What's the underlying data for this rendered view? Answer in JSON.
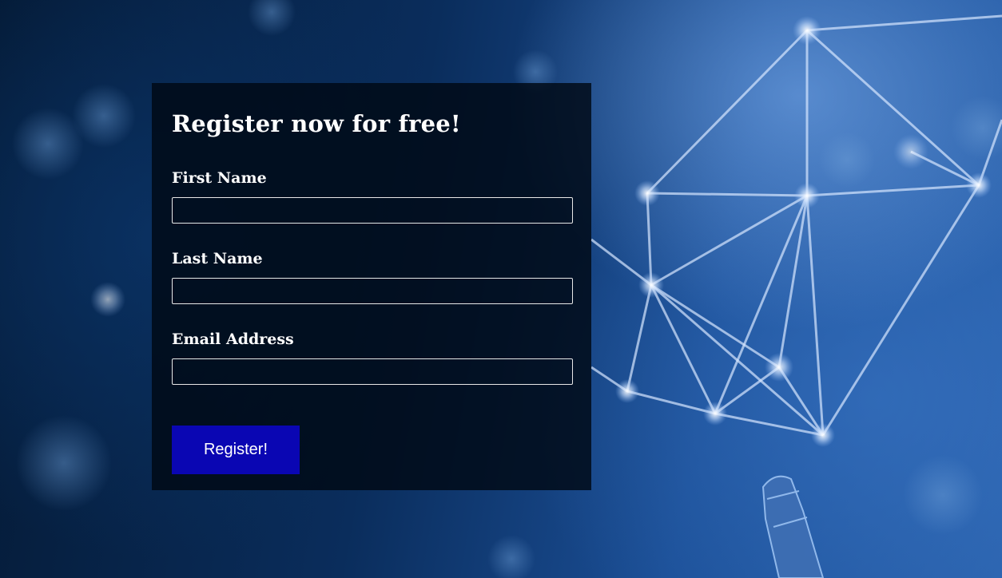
{
  "form": {
    "title": "Register now for free!",
    "first_name": {
      "label": "First Name",
      "value": ""
    },
    "last_name": {
      "label": "Last Name",
      "value": ""
    },
    "email": {
      "label": "Email Address",
      "value": ""
    },
    "submit_label": "Register!"
  },
  "colors": {
    "button_bg": "#0a06b3",
    "card_bg": "#000814",
    "background_accent": "#2a62ad",
    "text": "#ffffff"
  }
}
